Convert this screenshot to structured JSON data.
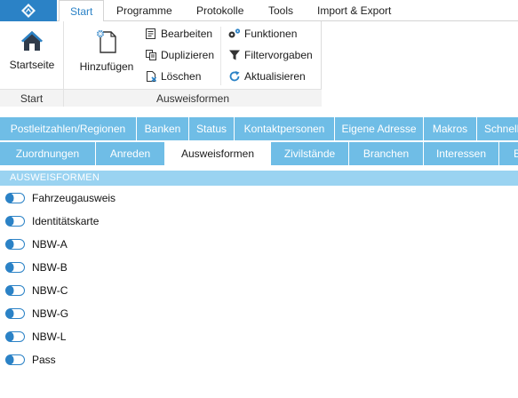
{
  "menubar": {
    "tabs": [
      {
        "label": "Start",
        "active": true
      },
      {
        "label": "Programme",
        "active": false
      },
      {
        "label": "Protokolle",
        "active": false
      },
      {
        "label": "Tools",
        "active": false
      },
      {
        "label": "Import & Export",
        "active": false
      }
    ]
  },
  "ribbon": {
    "start_group": {
      "startseite_label": "Startseite",
      "group_label": "Start"
    },
    "ausweis_group": {
      "hinzufuegen_label": "Hinzufügen",
      "bearbeiten_label": "Bearbeiten",
      "duplizieren_label": "Duplizieren",
      "loeschen_label": "Löschen",
      "funktionen_label": "Funktionen",
      "filtervorgaben_label": "Filtervorgaben",
      "aktualisieren_label": "Aktualisieren",
      "group_label": "Ausweisformen"
    }
  },
  "category_tabs_row1": [
    {
      "label": "Postleitzahlen/Regionen"
    },
    {
      "label": "Banken"
    },
    {
      "label": "Status"
    },
    {
      "label": "Kontaktpersonen"
    },
    {
      "label": "Eigene Adresse"
    },
    {
      "label": "Makros"
    },
    {
      "label": "Schnell"
    }
  ],
  "category_tabs_row2": [
    {
      "label": "Zuordnungen"
    },
    {
      "label": "Anreden"
    },
    {
      "label": "Ausweisformen",
      "active": true
    },
    {
      "label": "Zivilstände"
    },
    {
      "label": "Branchen"
    },
    {
      "label": "Interessen"
    },
    {
      "label": "B"
    }
  ],
  "section": {
    "title": "AUSWEISFORMEN"
  },
  "list_items": [
    {
      "label": "Fahrzeugausweis"
    },
    {
      "label": "Identitätskarte"
    },
    {
      "label": "NBW-A"
    },
    {
      "label": "NBW-B"
    },
    {
      "label": "NBW-C"
    },
    {
      "label": "NBW-G"
    },
    {
      "label": "NBW-L"
    },
    {
      "label": "Pass"
    }
  ],
  "colors": {
    "accent": "#2b82c6",
    "tab_blue": "#6fbde6",
    "header_blue": "#9ad3f1"
  }
}
